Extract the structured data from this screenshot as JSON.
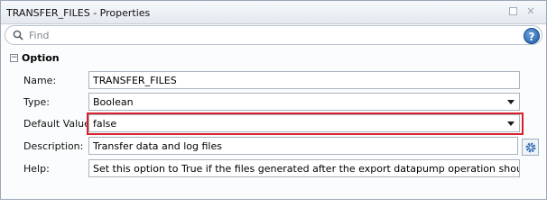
{
  "window": {
    "title": "TRANSFER_FILES - Properties"
  },
  "search": {
    "placeholder": "Find"
  },
  "help": {
    "glyph": "?"
  },
  "section": {
    "title": "Option",
    "toggle": "−"
  },
  "fields": {
    "name": {
      "label": "Name:",
      "value": "TRANSFER_FILES"
    },
    "type": {
      "label": "Type:",
      "value": "Boolean"
    },
    "default_value": {
      "label": "Default Value:",
      "value": "false"
    },
    "description": {
      "label": "Description:",
      "value": "Transfer data and log files"
    },
    "help": {
      "label": "Help:",
      "value": "Set this option to True if the files generated after the export datapump operation should be transf"
    }
  },
  "colors": {
    "highlight": "#d8212c",
    "accent": "#1f5aa6"
  }
}
